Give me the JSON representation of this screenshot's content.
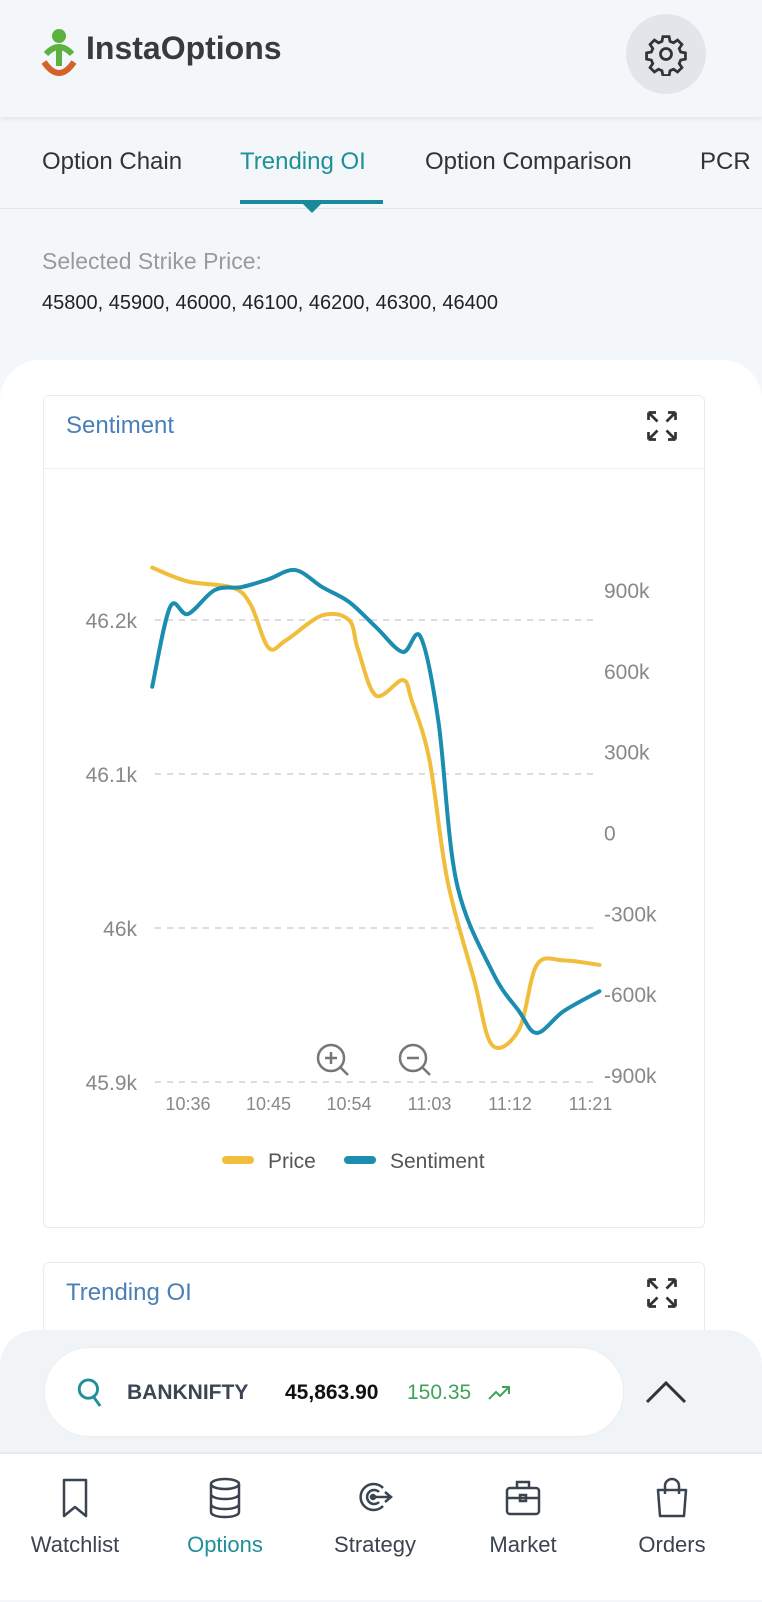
{
  "header": {
    "app_title": "InstaOptions",
    "settings_icon": "gear-icon"
  },
  "tabs": [
    {
      "label": "Option Chain",
      "active": false
    },
    {
      "label": "Trending OI",
      "active": true
    },
    {
      "label": "Option Comparison",
      "active": false
    },
    {
      "label": "PCR",
      "active": false
    }
  ],
  "strike": {
    "label": "Selected Strike Price:",
    "values": "45800, 45900, 46000, 46100, 46200, 46300, 46400"
  },
  "cards": [
    {
      "title": "Sentiment",
      "icon": "expand-icon"
    },
    {
      "title": "Trending OI",
      "icon": "expand-icon"
    }
  ],
  "colors": {
    "accent": "#1f8f98",
    "price": "#f0be3c",
    "sentiment": "#1b8db0"
  },
  "chart_data": {
    "type": "line",
    "x_ticks": [
      "10:36",
      "10:45",
      "10:54",
      "11:03",
      "11:12",
      "11:21"
    ],
    "y_left": {
      "ticks": [
        "46.2k",
        "46.1k",
        "46k",
        "45.9k"
      ],
      "tick_values": [
        46200,
        46100,
        46000,
        45900
      ],
      "ylim": [
        45900,
        46200
      ]
    },
    "y_right": {
      "ticks": [
        "900k",
        "600k",
        "300k",
        "0",
        "-300k",
        "-600k",
        "-900k"
      ],
      "tick_values": [
        900000,
        600000,
        300000,
        0,
        -300000,
        -600000,
        -900000
      ],
      "ylim": [
        -900000,
        900000
      ]
    },
    "grid": "dashed horizontal",
    "legend": "bottom",
    "series": [
      {
        "name": "Price",
        "axis": "left",
        "color": "#f0be3c",
        "points": [
          [
            "10:32",
            46234
          ],
          [
            "10:36",
            46225
          ],
          [
            "10:41",
            46221
          ],
          [
            "10:43",
            46210
          ],
          [
            "10:45",
            46182
          ],
          [
            "10:47",
            46187
          ],
          [
            "10:51",
            46203
          ],
          [
            "10:54",
            46200
          ],
          [
            "10:55",
            46181
          ],
          [
            "10:57",
            46151
          ],
          [
            "11:00",
            46161
          ],
          [
            "11:01",
            46148
          ],
          [
            "11:03",
            46109
          ],
          [
            "11:05",
            46031
          ],
          [
            "11:08",
            45966
          ],
          [
            "11:10",
            45924
          ],
          [
            "11:13",
            45934
          ],
          [
            "11:15",
            45976
          ],
          [
            "11:18",
            45979
          ],
          [
            "11:22",
            45976
          ]
        ]
      },
      {
        "name": "Sentiment",
        "axis": "right",
        "color": "#1b8db0",
        "points": [
          [
            "10:32",
            541000
          ],
          [
            "10:34",
            837000
          ],
          [
            "10:36",
            811000
          ],
          [
            "10:39",
            900000
          ],
          [
            "10:42",
            911000
          ],
          [
            "10:45",
            940000
          ],
          [
            "10:48",
            974000
          ],
          [
            "10:51",
            911000
          ],
          [
            "10:54",
            856000
          ],
          [
            "10:57",
            763000
          ],
          [
            "11:00",
            670000
          ],
          [
            "11:02",
            726000
          ],
          [
            "11:04",
            411000
          ],
          [
            "11:06",
            -181000
          ],
          [
            "11:10",
            -515000
          ],
          [
            "11:13",
            -663000
          ],
          [
            "11:15",
            -744000
          ],
          [
            "11:18",
            -663000
          ],
          [
            "11:22",
            -589000
          ]
        ]
      }
    ]
  },
  "ticker": {
    "symbol": "BANKNIFTY",
    "price": "45,863.90",
    "change": "150.35",
    "change_color": "#3fa35a"
  },
  "nav": [
    {
      "label": "Watchlist",
      "icon": "bookmark-icon",
      "active": false
    },
    {
      "label": "Options",
      "icon": "database-icon",
      "active": true
    },
    {
      "label": "Strategy",
      "icon": "target-icon",
      "active": false
    },
    {
      "label": "Market",
      "icon": "briefcase-icon",
      "active": false
    },
    {
      "label": "Orders",
      "icon": "shopping-bag-icon",
      "active": false
    }
  ]
}
